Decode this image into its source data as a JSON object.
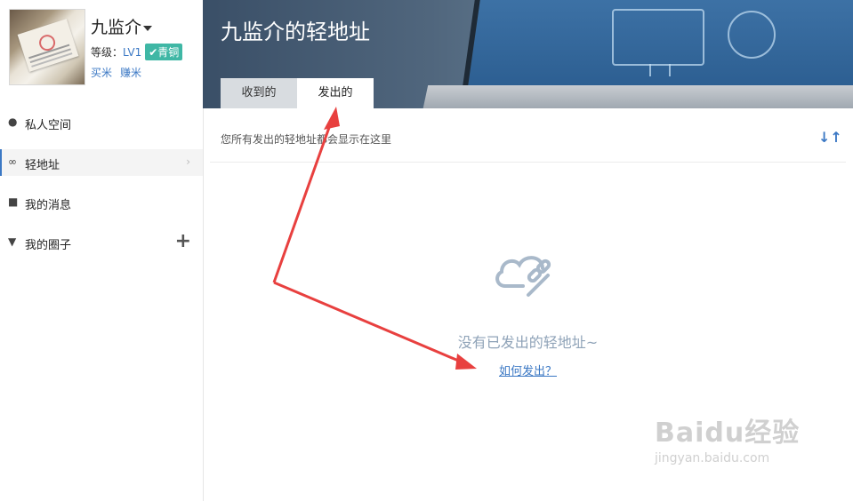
{
  "user": {
    "name": "九监介",
    "level_label": "等级：",
    "level_value": "LV1",
    "badge": "青铜",
    "links": [
      "买米",
      "赚米"
    ]
  },
  "sidebar": {
    "items": [
      {
        "label": "私人空间",
        "icon": "user-icon"
      },
      {
        "label": "轻地址",
        "icon": "link-icon",
        "active": true
      },
      {
        "label": "我的消息",
        "icon": "message-icon"
      },
      {
        "label": "我的圈子",
        "icon": "triangle-down-icon"
      }
    ]
  },
  "banner": {
    "title": "九监介的轻地址"
  },
  "tabs": [
    {
      "label": "收到的"
    },
    {
      "label": "发出的",
      "active": true
    }
  ],
  "content": {
    "hint": "您所有发出的轻地址都会显示在这里",
    "empty_message": "没有已发出的轻地址~",
    "how_link": "如何发出？"
  },
  "watermark": {
    "brand": "Baidu经验",
    "url": "jingyan.baidu.com"
  },
  "colors": {
    "accent": "#3b78c4",
    "badge": "#3fb7a5",
    "arrow": "#e8403f",
    "empty_text": "#8fa3b8"
  }
}
